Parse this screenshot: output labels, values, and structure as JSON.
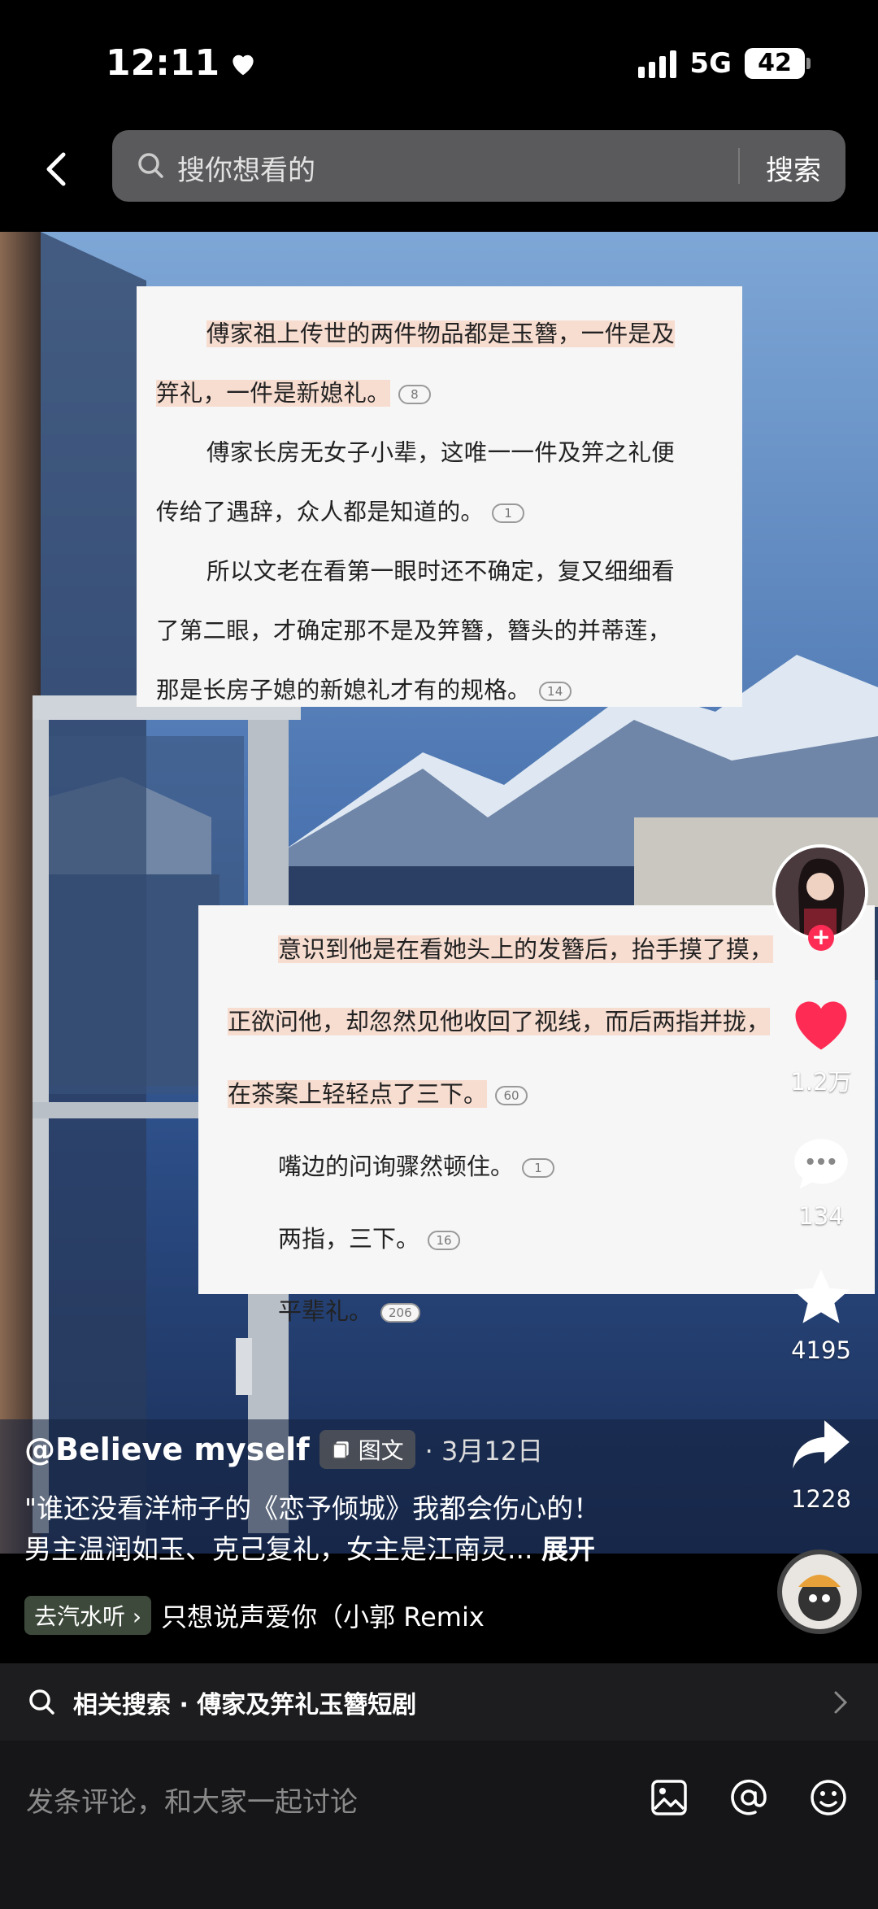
{
  "status_bar": {
    "time": "12:11",
    "network": "5G",
    "battery": "42"
  },
  "search": {
    "placeholder": "搜你想看的",
    "button": "搜索"
  },
  "card_top": {
    "lines": [
      "傅家祖上传世的两件物品都是玉簪，一件是及",
      "笄礼，一件是新媳礼。",
      "傅家长房无女子小辈，这唯一一件及笄之礼便",
      "传给了遇辞，众人都是知道的。",
      "所以文老在看第一眼时还不确定，复又细细看",
      "了第二眼，才确定那不是及笄簪，簪头的并蒂莲，",
      "那是长房子媳的新媳礼才有的规格。"
    ],
    "bubbles": [
      "8",
      "1",
      "14"
    ]
  },
  "card_bottom": {
    "lines": [
      "意识到他是在看她头上的发簪后，抬手摸了摸，",
      "正欲问他，却忽然见他收回了视线，而后两指并拢，",
      "在茶案上轻轻点了三下。",
      "嘴边的问询骤然顿住。",
      "两指，三下。",
      "平辈礼。"
    ],
    "bubbles": [
      "60",
      "1",
      "16",
      "206"
    ]
  },
  "actions": {
    "likes": "1.2万",
    "comments": "134",
    "favorites": "4195",
    "shares": "1228"
  },
  "post": {
    "author": "@Believe myself",
    "tag": "图文",
    "date": "· 3月12日",
    "desc_line1": "\"谁还没看洋柿子的《恋予倾城》我都会伤心的！",
    "desc_line2": "男主温润如玉、克己复礼，女主是江南灵...",
    "expand": "展开"
  },
  "music": {
    "tag": "去汽水听",
    "name": "只想说声爱你（小郭 Remix"
  },
  "related": {
    "text": "相关搜索 · 傅家及笄礼玉簪短剧"
  },
  "comment": {
    "placeholder": "发条评论，和大家一起讨论"
  },
  "colors": {
    "accent_like": "#fe2c55",
    "highlight": "#f7dcd0"
  }
}
